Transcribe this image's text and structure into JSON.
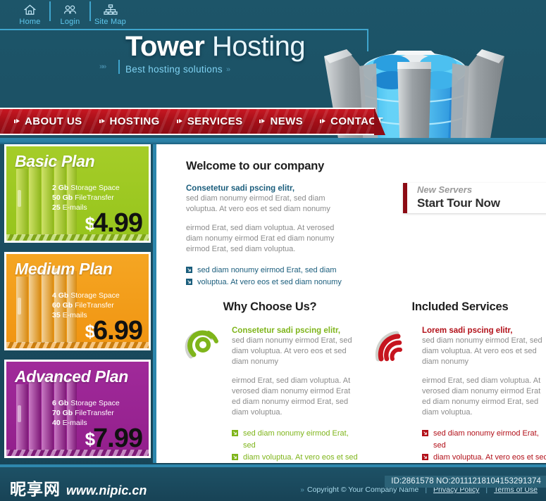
{
  "brand": {
    "title_bold": "Tower",
    "title_light": "Hosting",
    "tagline": "Best hosting solutions",
    "chev_left": "»»",
    "chev_right": "»"
  },
  "topnav": {
    "items": [
      {
        "label": "Home",
        "icon": "home-icon"
      },
      {
        "label": "Login",
        "icon": "users-icon"
      },
      {
        "label": "Site Map",
        "icon": "sitemap-icon"
      }
    ]
  },
  "mainnav": {
    "items": [
      {
        "label": "ABOUT US"
      },
      {
        "label": "HOSTING"
      },
      {
        "label": "SERVICES"
      },
      {
        "label": "NEWS"
      },
      {
        "label": "CONTACT"
      }
    ]
  },
  "plans": [
    {
      "name": "Basic Plan",
      "color": "#9ec81e",
      "storage_value": "2 Gb",
      "storage_label": "Storage Space",
      "transfer_value": "50 Gb",
      "transfer_label": "FileTransfer",
      "email_value": "25",
      "email_label": "E-mails",
      "currency": "$",
      "price": "4.99"
    },
    {
      "name": "Medium Plan",
      "color": "#f29c16",
      "storage_value": "4 Gb",
      "storage_label": "Storage Space",
      "transfer_value": "60 Gb",
      "transfer_label": "FileTransfer",
      "email_value": "35",
      "email_label": "E-mails",
      "currency": "$",
      "price": "6.99"
    },
    {
      "name": "Advanced Plan",
      "color": "#9a2392",
      "storage_value": "6 Gb",
      "storage_label": "Storage Space",
      "transfer_value": "70 Gb",
      "transfer_label": "FileTransfer",
      "email_value": "40",
      "email_label": "E-mails",
      "currency": "$",
      "price": "7.99"
    }
  ],
  "welcome": {
    "title": "Welcome to our company",
    "lead_head": "Consetetur sadi pscing elitr,",
    "lead_body": "sed diam nonumy eirmod Erat, sed diam voluptua. At vero eos et sed diam nonumy",
    "paragraph2": "eirmod Erat, sed diam voluptua. At verosed diam nonumy eirmod Erat ed diam nonumy eirmod Erat, sed diam voluptua.",
    "bullets": [
      "sed diam nonumy eirmod Erat, sed diam",
      "voluptua. At vero eos et sed diam nonumy"
    ]
  },
  "tour": {
    "kicker": "New Servers",
    "action": "Start Tour Now",
    "accent": "#8d0b14"
  },
  "why": {
    "title": "Why Choose Us?",
    "icon": "swirl-icon",
    "accent": "#7fb51b",
    "lead_head": "Consetetur sadi pscing elitr,",
    "lead_body": "sed diam nonumy eirmod Erat, sed diam voluptua. At vero eos et sed diam nonumy",
    "paragraph2": "eirmod Erat, sed diam voluptua. At verosed diam nonumy eirmod Erat ed diam nonumy eirmod Erat, sed diam voluptua.",
    "bullets": [
      "sed diam nonumy eirmod Erat, sed",
      "diam voluptua. At vero eos et sed"
    ]
  },
  "services": {
    "title": "Included Services",
    "icon": "signal-waves-icon",
    "accent": "#b21019",
    "lead_head": "Lorem sadi pscing elitr,",
    "lead_body": "sed diam nonumy eirmod Erat, sed diam voluptua. At vero eos et sed diam nonumy",
    "paragraph2": "eirmod Erat, sed diam voluptua. At verosed diam nonumy eirmod Erat ed diam nonumy eirmod Erat, sed diam voluptua.",
    "bullets": [
      "sed diam nonumy eirmod Erat, sed",
      "diam voluptua. At vero eos et sed"
    ]
  },
  "footer": {
    "watermark_cn": "昵享网",
    "watermark_url": "www.nipic.cn",
    "chev": "»",
    "copyright": "Copyright © Your Company Name",
    "sep": "|",
    "privacy": "Privacy Policy",
    "terms": "Terms of Use",
    "id_badge": "ID:2861578 NO:20111218104153291374"
  }
}
